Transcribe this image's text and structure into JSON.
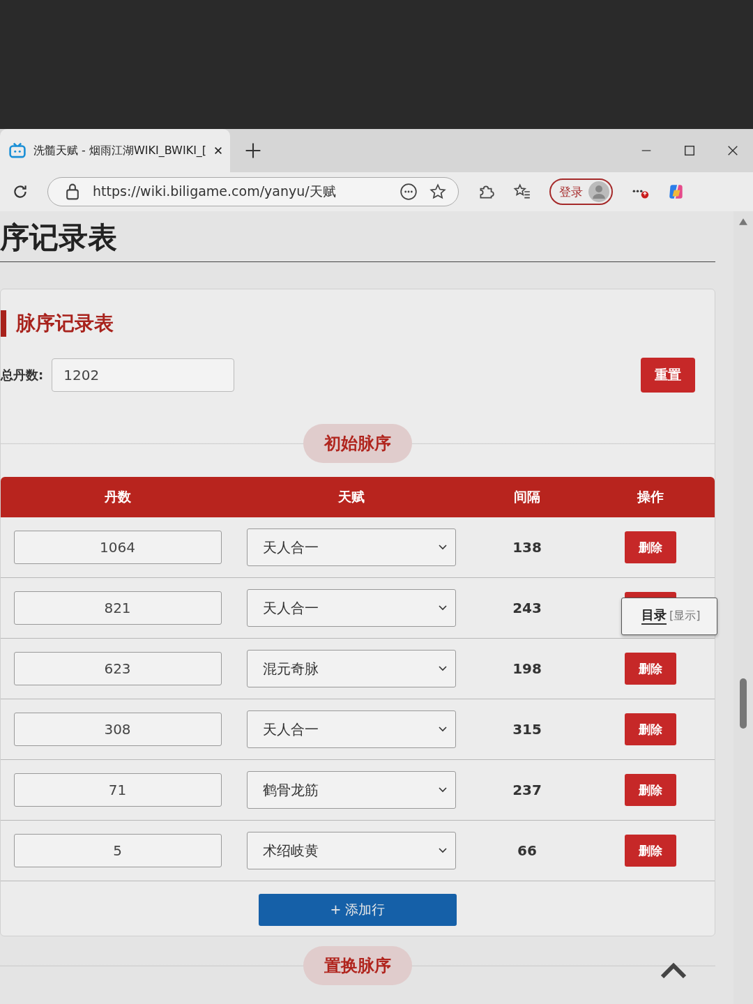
{
  "window": {
    "tab_title": "洗髓天赋 - 烟雨江湖WIKI_BWIKI_[",
    "url": "https://wiki.biligame.com/yanyu/天赋",
    "login": "登录"
  },
  "page": {
    "heading": "序记录表"
  },
  "card": {
    "title": "脉序记录表",
    "total_label": "总丹数:",
    "total_value": "1202",
    "reset": "重置",
    "section": "初始脉序",
    "columns": [
      "丹数",
      "天赋",
      "间隔",
      "操作"
    ],
    "rows": [
      {
        "dan": "1064",
        "talent": "天人合一",
        "gap": "138",
        "action": "删除"
      },
      {
        "dan": "821",
        "talent": "天人合一",
        "gap": "243"
      },
      {
        "dan": "623",
        "talent": "混元奇脉",
        "gap": "198",
        "action": "删除"
      },
      {
        "dan": "308",
        "talent": "天人合一",
        "gap": "315",
        "action": "删除"
      },
      {
        "dan": "71",
        "talent": "鹤骨龙筋",
        "gap": "237",
        "action": "删除"
      },
      {
        "dan": "5",
        "talent": "术绍岐黄",
        "gap": "66",
        "action": "删除"
      }
    ],
    "add_row": "+ 添加行"
  },
  "toc": {
    "label": "目录",
    "toggle": "[显示]"
  },
  "next_section": "置换脉序"
}
